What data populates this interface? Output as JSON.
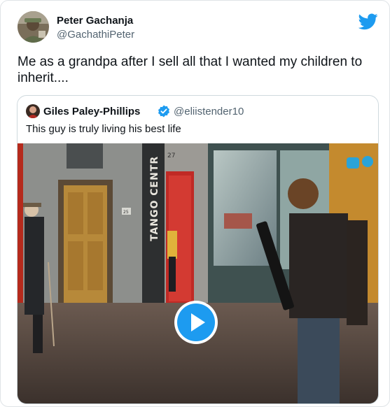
{
  "tweet": {
    "author_name": "Peter Gachanja",
    "author_handle": "@GachathiPeter",
    "text": "Me as a grandpa after I sell all that I wanted my children to inherit....",
    "brand_color": "#1d9bf0"
  },
  "quoted": {
    "author_name": "Giles Paley-Phillips",
    "author_handle": "@eliistender10",
    "verified": true,
    "text": "This guy is truly living his best life",
    "video": {
      "sign_text": "TANGO CENTR",
      "door_number": "27",
      "plate_number": "25",
      "play_icon": "play-icon"
    }
  }
}
